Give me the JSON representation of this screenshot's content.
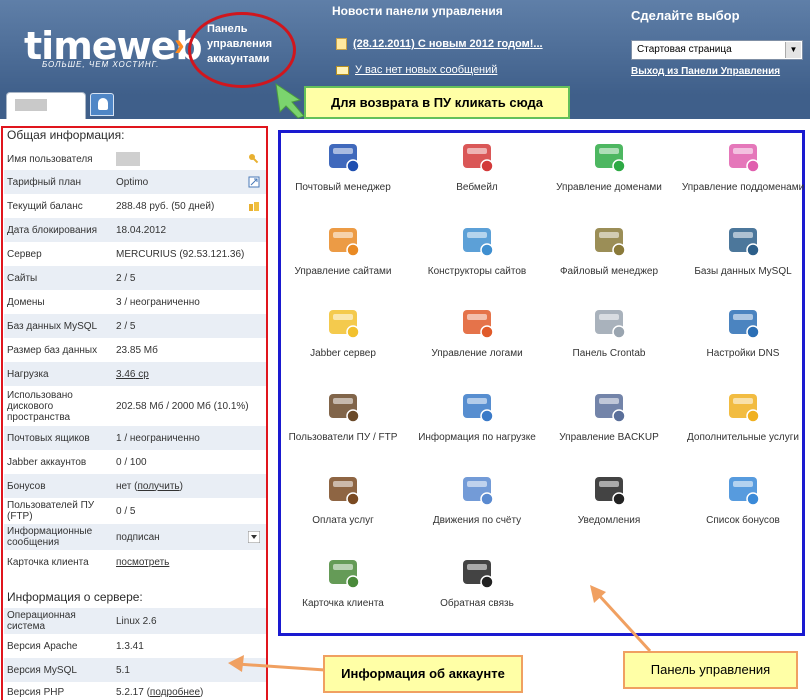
{
  "header": {
    "logo_text": "timeweb",
    "logo_tagline": "БОЛЬШЕ, ЧЕМ ХОСТИНГ.",
    "panel_link": "Панель управления аккаунтами",
    "news_title": "Новости панели управления",
    "news_item": "(28.12.2011) С новым 2012 годом!...",
    "messages": "У вас нет новых сообщений",
    "choice_title": "Сделайте выбор",
    "choice_selected": "Стартовая страница",
    "exit_link": "Выход из Панели Управления"
  },
  "callouts": {
    "return_hint": "Для возврата в ПУ кликать сюда",
    "account_info": "Информация об аккаунте",
    "control_panel": "Панель управления"
  },
  "general": {
    "title": "Общая информация:",
    "rows": [
      {
        "label": "Имя пользователя",
        "value": ""
      },
      {
        "label": "Тарифный план",
        "value": "Optimo"
      },
      {
        "label": "Текущий баланс",
        "value": "288.48 руб. (50 дней)"
      },
      {
        "label": "Дата блокирования",
        "value": "18.04.2012"
      },
      {
        "label": "Сервер",
        "value": "MERCURIUS (92.53.121.36)"
      },
      {
        "label": "Сайты",
        "value": "2 / 5"
      },
      {
        "label": "Домены",
        "value": "3 / неограниченно"
      },
      {
        "label": "Баз данных MySQL",
        "value": "2 / 5"
      },
      {
        "label": "Размер баз данных",
        "value": "23.85 Мб"
      },
      {
        "label": "Нагрузка",
        "value": "3.46 ср"
      },
      {
        "label": "Использовано дискового пространства",
        "value": "202.58 Мб / 2000 Мб (10.1%)"
      },
      {
        "label": "Почтовых ящиков",
        "value": "1 / неограниченно"
      },
      {
        "label": "Jabber аккаунтов",
        "value": "0 / 100"
      },
      {
        "label": "Бонусов",
        "value": "нет",
        "link": "получить"
      },
      {
        "label": "Пользователей ПУ (FTP)",
        "value": "0 / 5"
      },
      {
        "label": "Информационные сообщения",
        "value": "подписан"
      },
      {
        "label": "Карточка клиента",
        "value": "посмотреть"
      }
    ]
  },
  "server": {
    "title": "Информация о сервере:",
    "rows": [
      {
        "label": "Операционная система",
        "value": "Linux 2.6"
      },
      {
        "label": "Версия Apache",
        "value": "1.3.41"
      },
      {
        "label": "Версия MySQL",
        "value": "5.1"
      },
      {
        "label": "Версия PHP",
        "value": "5.2.17",
        "link": "подробнее"
      }
    ]
  },
  "cp_items": [
    {
      "label": "Почтовый менеджер",
      "icon": "mail-manager-icon",
      "color": "#1f4fb0"
    },
    {
      "label": "Вебмейл",
      "icon": "webmail-icon",
      "color": "#d33a3a"
    },
    {
      "label": "Управление доменами",
      "icon": "domains-icon",
      "color": "#2eaa45"
    },
    {
      "label": "Управление поддоменами",
      "icon": "subdomains-icon",
      "color": "#e05fae"
    },
    {
      "label": "Управление сайтами",
      "icon": "sites-icon",
      "color": "#e98a24"
    },
    {
      "label": "Конструкторы сайтов",
      "icon": "site-builder-icon",
      "color": "#3f8fd0"
    },
    {
      "label": "Файловый менеджер",
      "icon": "file-manager-icon",
      "color": "#8a7a3a"
    },
    {
      "label": "Базы данных MySQL",
      "icon": "mysql-icon",
      "color": "#2d5f8a"
    },
    {
      "label": "Jabber сервер",
      "icon": "jabber-icon",
      "color": "#f2c12e"
    },
    {
      "label": "Управление логами",
      "icon": "logs-icon",
      "color": "#e05a2a"
    },
    {
      "label": "Панель Crontab",
      "icon": "crontab-icon",
      "color": "#9aa5b0"
    },
    {
      "label": "Настройки DNS",
      "icon": "dns-icon",
      "color": "#2b6fb5"
    },
    {
      "label": "Пользователи ПУ / FTP",
      "icon": "users-icon",
      "color": "#6b4a2a"
    },
    {
      "label": "Информация по нагрузке",
      "icon": "load-chart-icon",
      "color": "#3a7ac8"
    },
    {
      "label": "Управление BACKUP",
      "icon": "backup-icon",
      "color": "#5a6f9a"
    },
    {
      "label": "Дополнительные услуги",
      "icon": "extra-services-icon",
      "color": "#f0b020"
    },
    {
      "label": "Оплата услуг",
      "icon": "wallet-icon",
      "color": "#7a4a22"
    },
    {
      "label": "Движения по счёту",
      "icon": "account-moves-icon",
      "color": "#5a8ad0"
    },
    {
      "label": "Уведомления",
      "icon": "phone-icon",
      "color": "#222222"
    },
    {
      "label": "Список бонусов",
      "icon": "gift-icon",
      "color": "#3a8ad8"
    },
    {
      "label": "Карточка клиента",
      "icon": "client-card-icon",
      "color": "#4a8a3a"
    },
    {
      "label": "Обратная связь",
      "icon": "headset-icon",
      "color": "#222222"
    }
  ]
}
